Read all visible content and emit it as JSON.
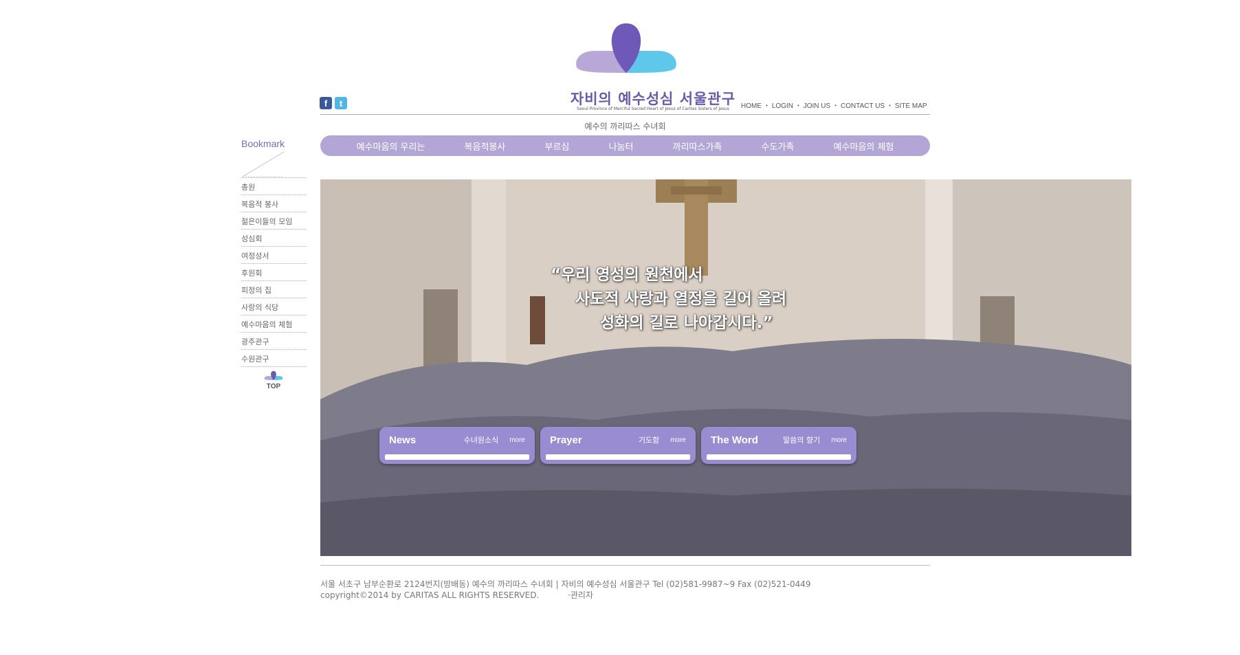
{
  "header": {
    "site_title": "자비의 예수성심 서울관구",
    "site_subtitle": "Seoul Province of Merciful Sacred Heart of Jesus of Caritas Sisters of Jesus",
    "tagline": "예수의 까리따스 수녀회",
    "top_links": [
      "HOME",
      "LOGIN",
      "JOIN US",
      "CONTACT US",
      "SITE MAP"
    ],
    "social": {
      "facebook": "f",
      "twitter": "t"
    }
  },
  "nav": {
    "items": [
      "예수마음의 우리는",
      "복음적봉사",
      "부르심",
      "나눔터",
      "까리따스가족",
      "수도가족",
      "예수마음의 체험"
    ]
  },
  "sidebar": {
    "title": "Bookmark",
    "items": [
      "총원",
      "복음적 봉사",
      "젊은이들의 모임",
      "성심회",
      "여정성서",
      "후원회",
      "피정의 집",
      "사랑의 식당",
      "예수마음의 체험",
      "광주관구",
      "수원관구"
    ],
    "top_label": "TOP"
  },
  "hero": {
    "quote_lines": [
      "“우리 영성의 원천에서",
      "사도적 사랑과 열정을 길어 올려",
      "성화의 길로 나아갑시다.”"
    ],
    "boxes": [
      {
        "title": "News",
        "subtitle": "수녀원소식",
        "more": "more"
      },
      {
        "title": "Prayer",
        "subtitle": "기도함",
        "more": "more"
      },
      {
        "title": "The Word",
        "subtitle": "말씀의 향기",
        "more": "more"
      }
    ]
  },
  "footer": {
    "address": "서울 서초구 남부순환로 2124번지(방배동) 예수의 까리따스 수녀회 | 자비의 예수성심 서울관구 Tel (02)581-9987~9 Fax (02)521-0449",
    "copyright": "copyright©2014 by CARITAS ALL RIGHTS RESERVED.",
    "admin": "·관리자"
  },
  "colors": {
    "accent": "#b3a6d6",
    "brand": "#6a5aa8",
    "box": "#9a8cd0"
  }
}
